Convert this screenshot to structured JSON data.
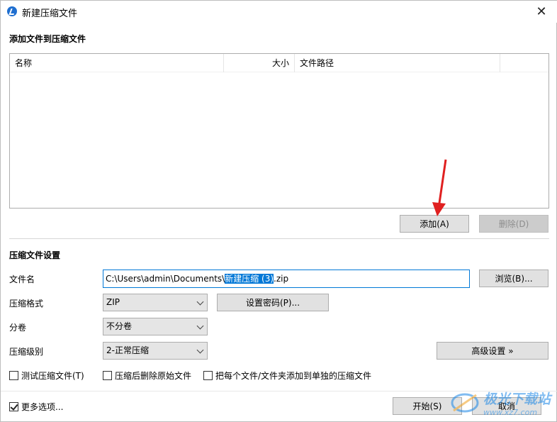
{
  "window": {
    "title": "新建压缩文件",
    "close_glyph": "✕"
  },
  "files_section": {
    "title": "添加文件到压缩文件",
    "columns": [
      "名称",
      "大小",
      "文件路径"
    ],
    "add_button": "添加(A)",
    "delete_button": "删除(D)"
  },
  "settings": {
    "title": "压缩文件设置",
    "filename_label": "文件名",
    "filename_prefix": "C:\\Users\\admin\\Documents\\",
    "filename_selected": "新建压缩 (3)",
    "filename_suffix": ".zip",
    "browse_button": "浏览(B)...",
    "format_label": "压缩格式",
    "format_value": "ZIP",
    "password_button": "设置密码(P)...",
    "volume_label": "分卷",
    "volume_value": "不分卷",
    "level_label": "压缩级别",
    "level_value": "2-正常压缩",
    "advanced_button": "高级设置 »",
    "checkboxes": [
      {
        "label": "测试压缩文件(T)",
        "checked": false
      },
      {
        "label": "压缩后删除原始文件",
        "checked": false
      },
      {
        "label": "把每个文件/文件夹添加到单独的压缩文件",
        "checked": false
      }
    ]
  },
  "footer": {
    "more_options": {
      "label": "更多选项...",
      "checked": true
    },
    "start_button": "开始(S)",
    "cancel_button": "取消"
  },
  "watermark": {
    "main": "极光下载站",
    "sub": "www.xz7.com"
  },
  "colors": {
    "accent": "#0078d7",
    "arrow": "#e02020"
  }
}
